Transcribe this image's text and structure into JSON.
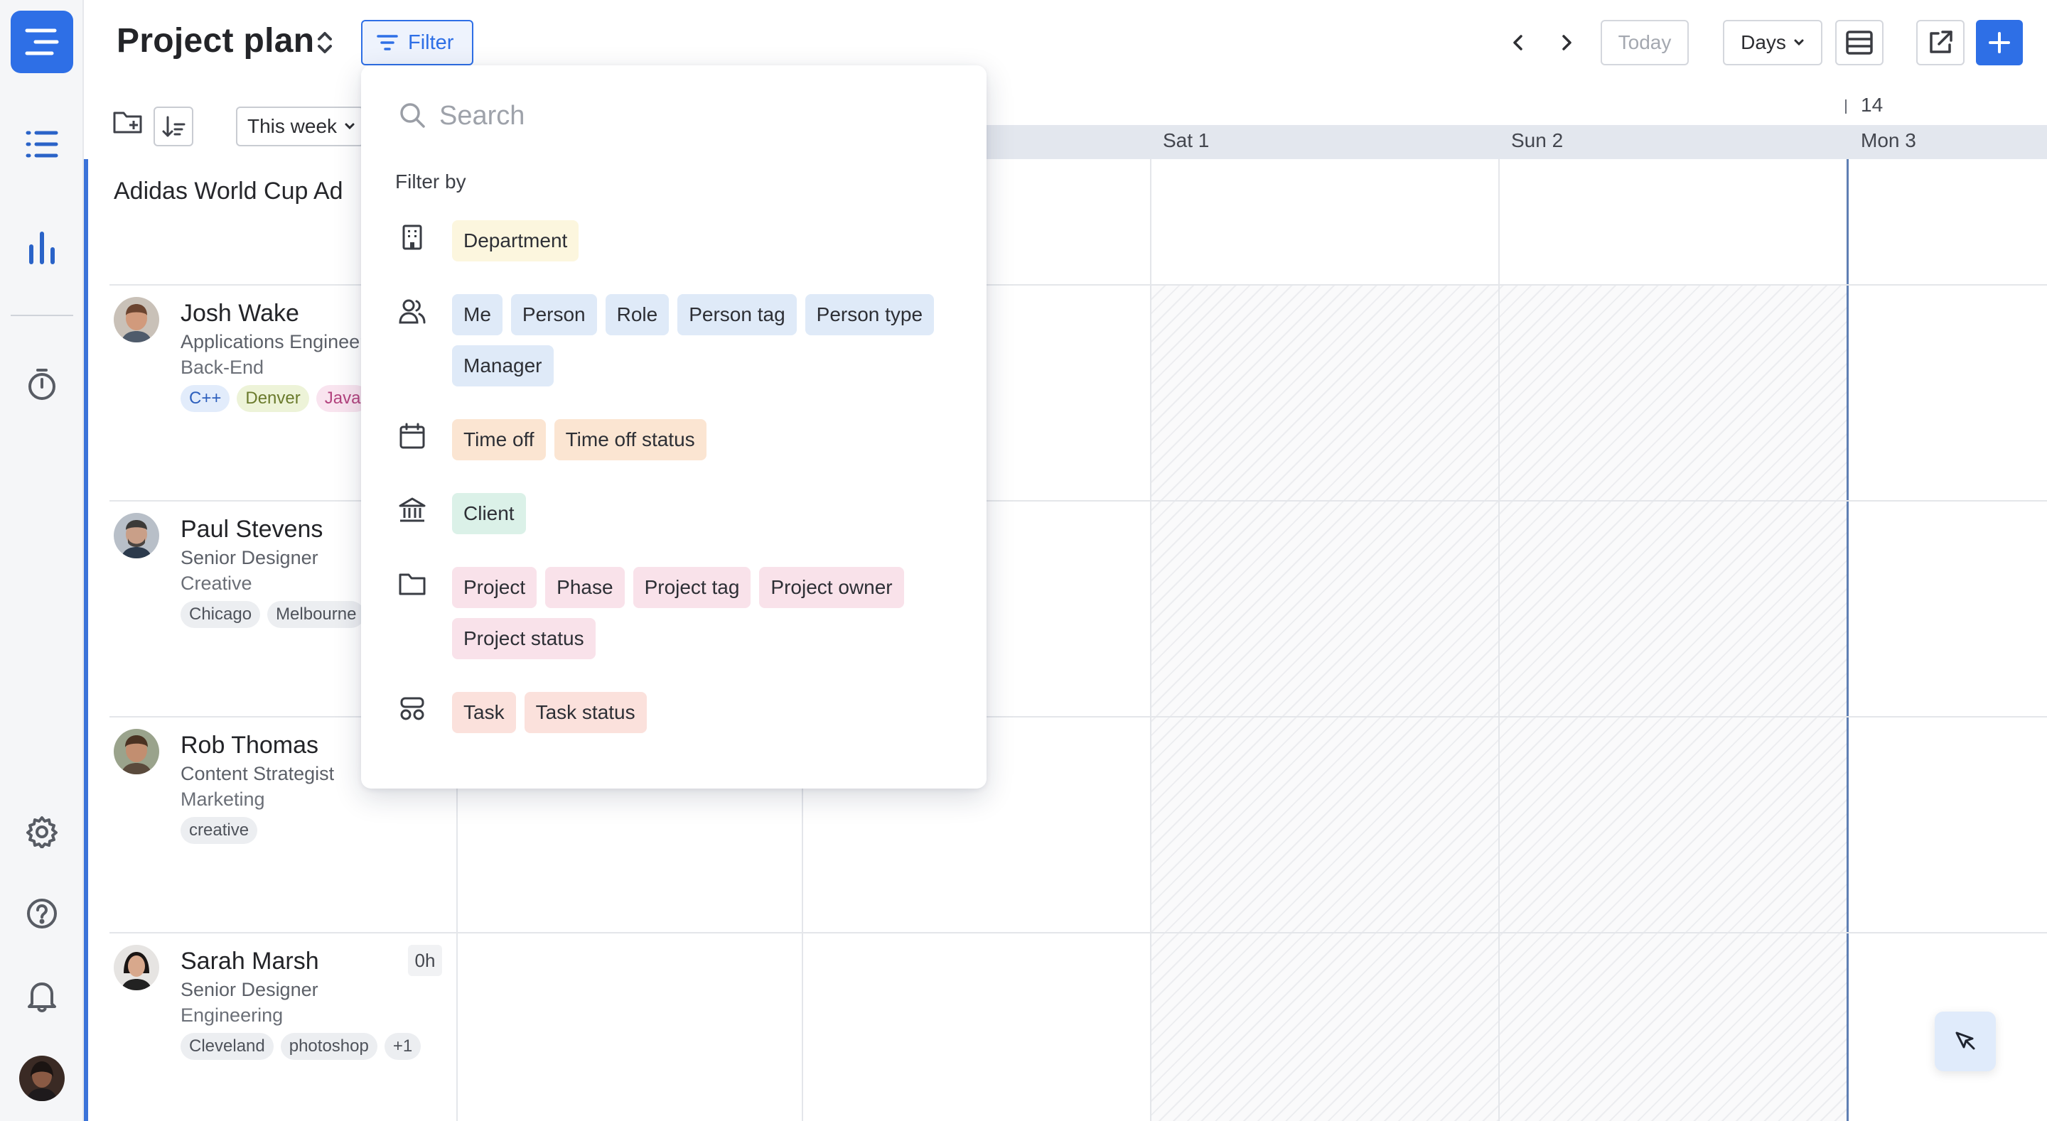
{
  "app": {
    "title": "Project plan",
    "filter_label": "Filter",
    "today_label": "Today",
    "view_label": "Days"
  },
  "toolbar": {
    "week_select": "This week"
  },
  "project": {
    "name": "Adidas World Cup Ad"
  },
  "people": [
    {
      "name": "Josh Wake",
      "role": "Applications Engineer",
      "department": "Back-End",
      "tags": [
        "C++",
        "Denver",
        "Java"
      ],
      "hours": ""
    },
    {
      "name": "Paul Stevens",
      "role": "Senior Designer",
      "department": "Creative",
      "tags": [
        "Chicago",
        "Melbourne"
      ],
      "hours": ""
    },
    {
      "name": "Rob Thomas",
      "role": "Content Strategist",
      "department": "Marketing",
      "tags": [
        "creative"
      ],
      "hours": ""
    },
    {
      "name": "Sarah Marsh",
      "role": "Senior Designer",
      "department": "Engineering",
      "tags": [
        "Cleveland",
        "photoshop",
        "+1"
      ],
      "hours": "0h"
    }
  ],
  "calendar": {
    "week_number": "14",
    "days": [
      "Sat 1",
      "Sun 2",
      "Mon 3"
    ]
  },
  "filter_popup": {
    "search_placeholder": "Search",
    "filter_by_label": "Filter by",
    "groups": [
      {
        "icon": "building-icon",
        "chips": [
          "Department"
        ]
      },
      {
        "icon": "people-icon",
        "chips": [
          "Me",
          "Person",
          "Role",
          "Person tag",
          "Person type",
          "Manager"
        ]
      },
      {
        "icon": "calendar-icon",
        "chips": [
          "Time off",
          "Time off status"
        ]
      },
      {
        "icon": "bank-icon",
        "chips": [
          "Client"
        ]
      },
      {
        "icon": "folder-icon",
        "chips": [
          "Project",
          "Phase",
          "Project tag",
          "Project owner",
          "Project status"
        ]
      },
      {
        "icon": "task-icon",
        "chips": [
          "Task",
          "Task status"
        ]
      }
    ]
  },
  "colors": {
    "accent": "#2e6fe6",
    "chip_department": "#fcf6de",
    "chip_person": "#dfeaf8",
    "chip_timeoff": "#fbe5d2",
    "chip_client": "#dbf1e8",
    "chip_project": "#f9e2ea",
    "chip_task": "#fbe1dc"
  }
}
